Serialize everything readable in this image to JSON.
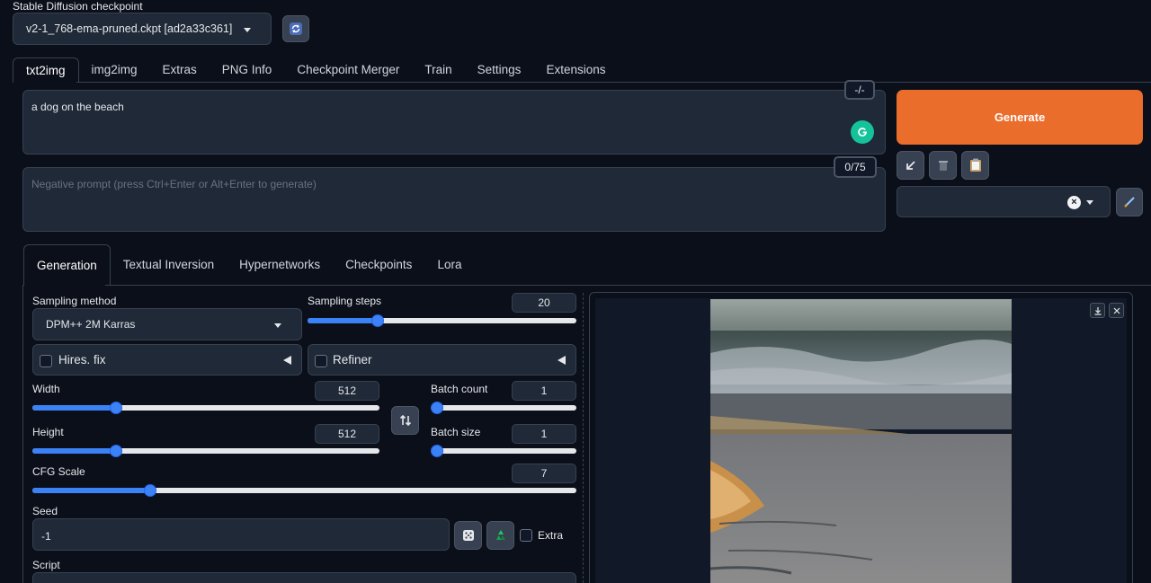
{
  "checkpoint": {
    "label": "Stable Diffusion checkpoint",
    "value": "v2-1_768-ema-pruned.ckpt [ad2a33c361]"
  },
  "main_tabs": [
    "txt2img",
    "img2img",
    "Extras",
    "PNG Info",
    "Checkpoint Merger",
    "Train",
    "Settings",
    "Extensions"
  ],
  "prompt": {
    "value": "a dog on the beach",
    "token_counter": "-/-"
  },
  "negative_prompt": {
    "placeholder": "Negative prompt (press Ctrl+Enter or Alt+Enter to generate)",
    "token_counter": "0/75"
  },
  "generate_label": "Generate",
  "extra_tabs": [
    "Generation",
    "Textual Inversion",
    "Hypernetworks",
    "Checkpoints",
    "Lora"
  ],
  "sampling": {
    "method_label": "Sampling method",
    "method_value": "DPM++ 2M Karras",
    "steps_label": "Sampling steps",
    "steps_value": "20",
    "steps_fraction": 0.25
  },
  "hires_label": "Hires. fix",
  "refiner_label": "Refiner",
  "width": {
    "label": "Width",
    "value": "512",
    "fraction": 0.23
  },
  "height": {
    "label": "Height",
    "value": "512",
    "fraction": 0.23
  },
  "batch_count": {
    "label": "Batch count",
    "value": "1",
    "fraction": 0.0
  },
  "batch_size": {
    "label": "Batch size",
    "value": "1",
    "fraction": 0.0
  },
  "cfg": {
    "label": "CFG Scale",
    "value": "7",
    "fraction": 0.21
  },
  "seed": {
    "label": "Seed",
    "value": "-1",
    "extra_label": "Extra"
  },
  "script_label": "Script",
  "colors": {
    "accent": "#3b82f6",
    "generate": "#ea6d2c",
    "background": "#0b0f19",
    "panel": "#1f2937"
  }
}
